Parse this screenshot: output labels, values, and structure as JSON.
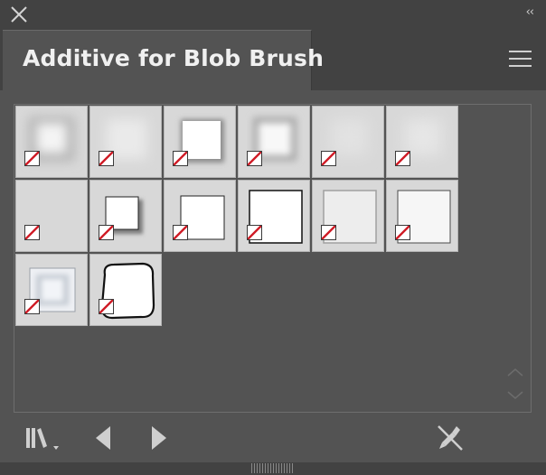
{
  "panel": {
    "title": "Additive for Blob Brush"
  },
  "icons": {
    "close": "close-icon",
    "collapse": "double-chevron-left-icon",
    "menu": "hamburger-menu-icon",
    "library": "brush-library-menu-icon",
    "previous": "previous-library-icon",
    "next": "next-library-icon",
    "remove_brush": "remove-brush-stroke-icon"
  },
  "collapse_glyph": "‹‹",
  "colors": {
    "panel_bg": "#535353",
    "titlebar_bg": "#424242",
    "thumb_bg": "#d8d8d8",
    "indicator_red": "#d0202a"
  },
  "brushes": [
    {
      "id": "brush-01",
      "style": "soft-blur-square"
    },
    {
      "id": "brush-02",
      "style": "faint-blur"
    },
    {
      "id": "brush-03",
      "style": "shadow-glow-square"
    },
    {
      "id": "brush-04",
      "style": "soft-glow-square"
    },
    {
      "id": "brush-05",
      "style": "very-faint-blur"
    },
    {
      "id": "brush-06",
      "style": "faint-blur-light"
    },
    {
      "id": "brush-07",
      "style": "blank"
    },
    {
      "id": "brush-08",
      "style": "drop-shadow-square"
    },
    {
      "id": "brush-09",
      "style": "outlined-square"
    },
    {
      "id": "brush-10",
      "style": "outlined-square-large"
    },
    {
      "id": "brush-11",
      "style": "light-outline-square"
    },
    {
      "id": "brush-12",
      "style": "flat-square"
    },
    {
      "id": "brush-13",
      "style": "bevel-frame-square"
    },
    {
      "id": "brush-14",
      "style": "rough-rounded-square"
    }
  ]
}
